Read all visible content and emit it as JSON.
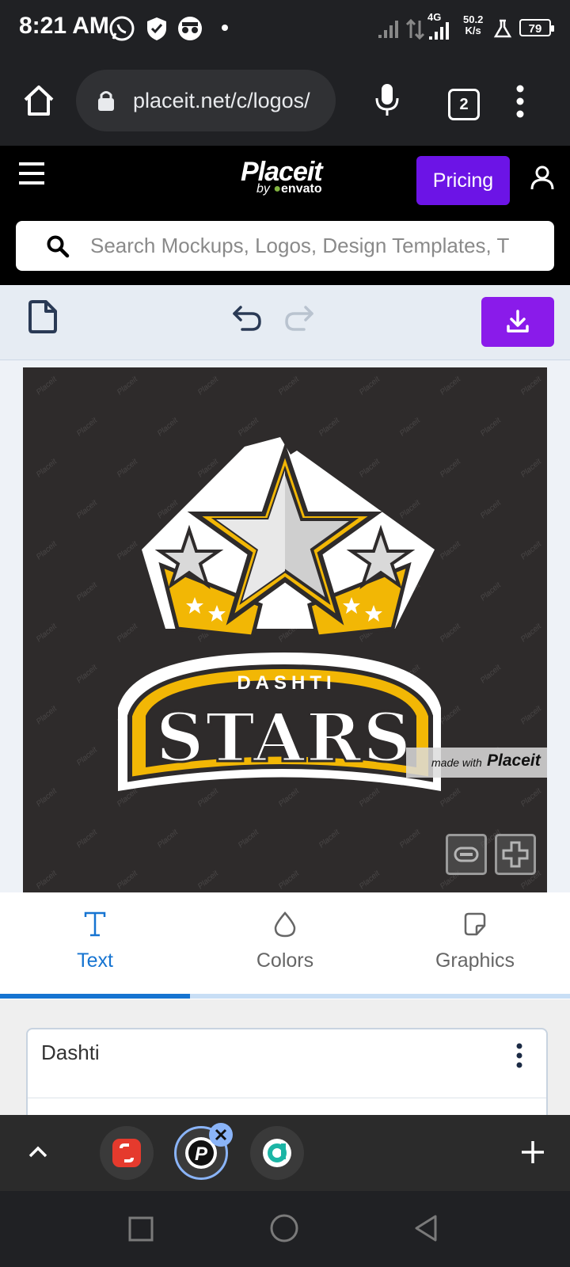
{
  "status_bar": {
    "time": "8:21 AM",
    "network": "4G",
    "speed_value": "50.2",
    "speed_unit": "K/s",
    "battery": "79"
  },
  "browser": {
    "url": "placeit.net/c/logos/",
    "tab_count": "2"
  },
  "header": {
    "logo": "Placeit",
    "logo_sub_by": "by",
    "logo_sub_brand": "envato",
    "pricing_label": "Pricing",
    "search_placeholder": "Search Mockups, Logos, Design Templates, T"
  },
  "canvas": {
    "logo_line1": "DASHTI",
    "logo_line2": "STARS",
    "watermark_text": "Placeit",
    "badge_made_with": "made with",
    "badge_brand": "Placeit"
  },
  "tabs": [
    {
      "label": "Text",
      "icon": "text-icon",
      "active": true
    },
    {
      "label": "Colors",
      "icon": "droplet-icon",
      "active": false
    },
    {
      "label": "Graphics",
      "icon": "sticker-icon",
      "active": false
    }
  ],
  "panel": {
    "text_value": "Dashti"
  },
  "colors": {
    "accent_purple": "#8a1bea",
    "pricing_purple": "#6c14e6",
    "active_tab_blue": "#1674d1",
    "logo_gold": "#f2b705"
  }
}
